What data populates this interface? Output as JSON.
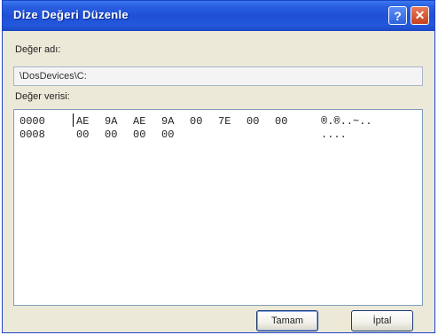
{
  "window": {
    "title": "Dize Değeri Düzenle",
    "help_glyph": "?",
    "close_glyph": "✕"
  },
  "value_name": {
    "label": "Değer adı:",
    "value": "\\DosDevices\\C:"
  },
  "value_data": {
    "label": "Değer verisi:",
    "rows": [
      {
        "offset": "0000",
        "bytes": [
          "AE",
          "9A",
          "AE",
          "9A",
          "00",
          "7E",
          "00",
          "00"
        ],
        "ascii": "®.®..~.."
      },
      {
        "offset": "0008",
        "bytes": [
          "00",
          "00",
          "00",
          "00"
        ],
        "ascii": "...."
      }
    ]
  },
  "buttons": {
    "ok": "Tamam",
    "cancel": "İptal"
  },
  "colors": {
    "titlebar": "#2458dc",
    "dialog_bg": "#ece9d8"
  }
}
